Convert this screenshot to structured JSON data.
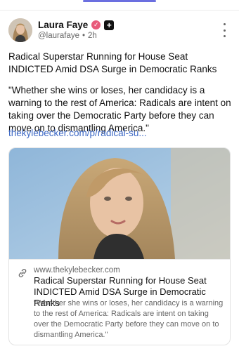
{
  "author": {
    "display_name": "Laura Faye",
    "handle": "@laurafaye",
    "separator": "•",
    "time": "2h",
    "plus_badge": "+"
  },
  "post": {
    "title": "Radical Superstar Running for House Seat INDICTED Amid DSA Surge in Democratic Ranks",
    "quote": "\"Whether she wins or loses, her candidacy is a warning to the rest of America: Radicals are intent on taking over the Democratic Party before they can move on to dismantling America.\"",
    "link_text": "thekylebecker.com/p/radical-su..."
  },
  "link_card": {
    "domain": "www.thekylebecker.com",
    "title": "Radical Superstar Running for House Seat INDICTED Amid DSA Surge in Democratic Ranks",
    "description": "\"Whether she wins or loses, her candidacy is a warning to the rest of America: Radicals are intent on taking over the Democratic Party before they can move on to dismantling America.\""
  },
  "icons": {
    "verified": "verified-badge-icon",
    "more": "more-vertical-icon",
    "link": "link-icon"
  },
  "colors": {
    "accent": "#6b6fe0",
    "link": "#3b67c4",
    "verified": "#e85a7a"
  }
}
